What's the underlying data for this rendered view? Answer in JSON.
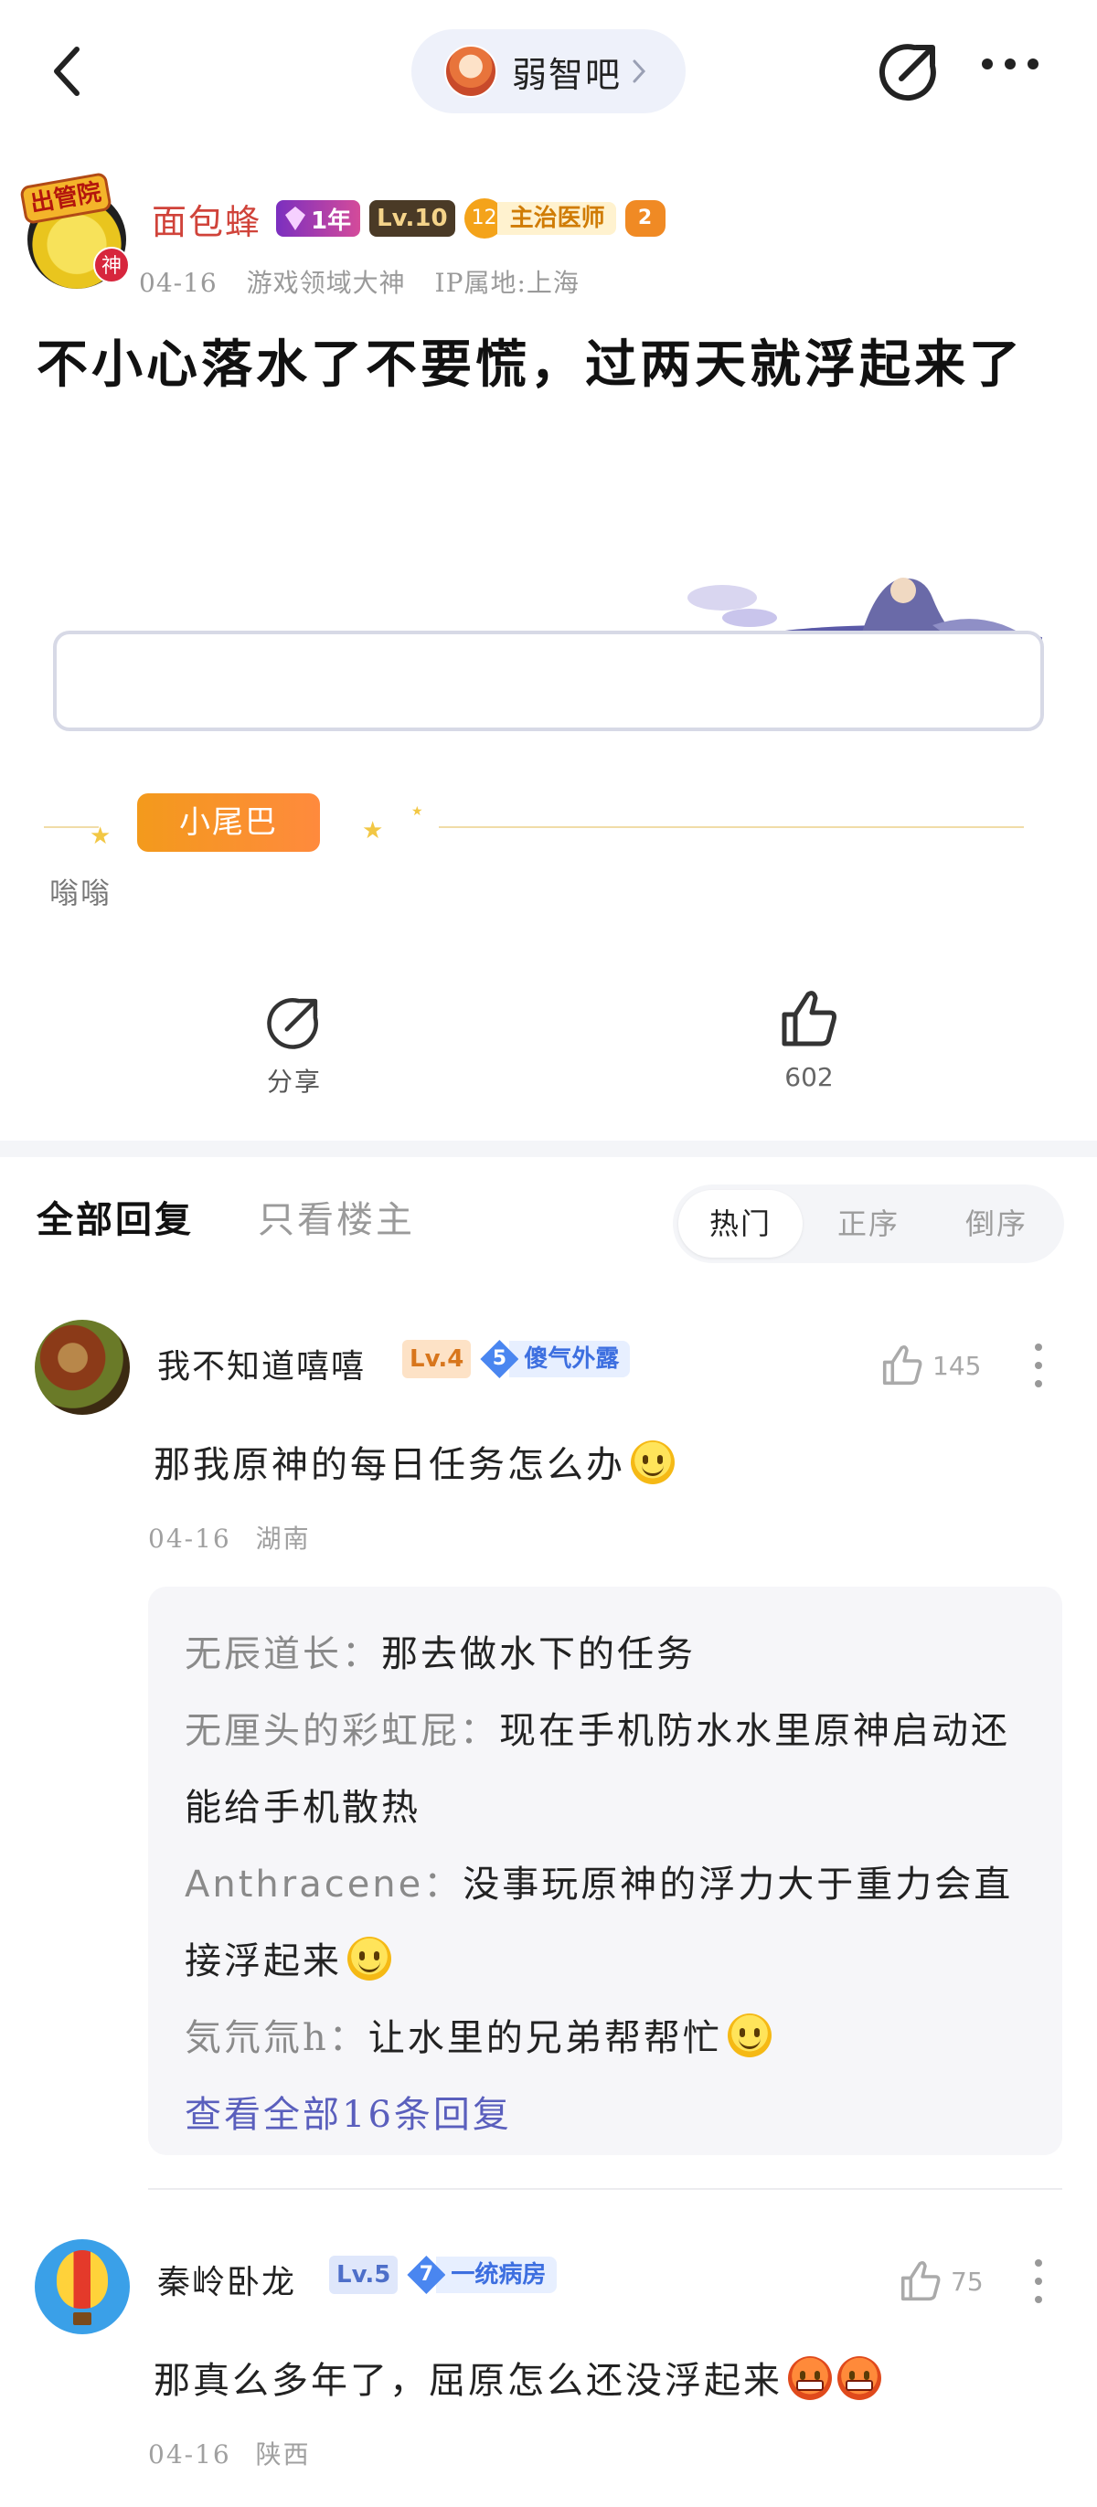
{
  "header": {
    "forum_name": "弱智吧"
  },
  "post": {
    "author": {
      "name": "面包蜂",
      "avatar_hat_text": "出管院",
      "avatar_badge": "神",
      "year_badge": "1年",
      "level": "Lv.10",
      "title_number": "12",
      "title": "主治医师",
      "game_badge": "2"
    },
    "date": "04-16",
    "honor": "游戏领域大神",
    "ip": "IP属地:上海",
    "title": "不小心落水了不要慌，过两天就浮起来了",
    "tail_label": "小尾巴",
    "tail_text": "嗡嗡",
    "share_label": "分享",
    "like_count": "602"
  },
  "tabs": {
    "all": "全部回复",
    "op_only": "只看楼主",
    "sort": [
      "热门",
      "正序",
      "倒序"
    ]
  },
  "comments": [
    {
      "name": "我不知道嘻嘻",
      "level": "Lv.4",
      "fan_level": "5",
      "fan_title": "傻气外露",
      "likes": "145",
      "text": "那我原神的每日任务怎么办",
      "date": "04-16",
      "location": "湖南",
      "replies": [
        {
          "user": "无辰道长",
          "text": "那去做水下的任务"
        },
        {
          "user": "无厘头的彩虹屁",
          "text": "现在手机防水水里原神启动还能给手机散热"
        },
        {
          "user": "Anthracene",
          "text": "没事玩原神的浮力大于重力会直接浮起来"
        },
        {
          "user": "気氘氚h",
          "text": "让水里的兄弟帮帮忙"
        }
      ],
      "view_all": "查看全部16条回复"
    },
    {
      "name": "秦岭卧龙",
      "level": "Lv.5",
      "fan_level": "7",
      "fan_title": "一统病房",
      "likes": "75",
      "text": "那真么多年了，屈原怎么还没浮起来",
      "date": "04-16",
      "location": "陕西"
    }
  ],
  "colors": {
    "accent_name": "#d0433a",
    "link": "#5a5fbd",
    "muted": "#9a9a9a"
  }
}
